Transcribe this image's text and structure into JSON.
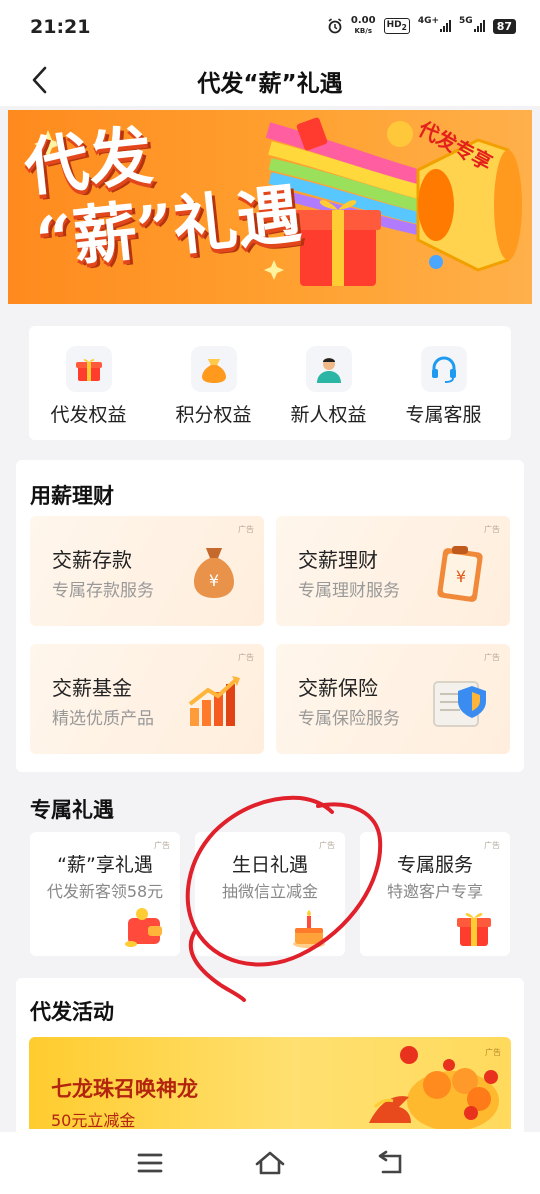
{
  "status_bar": {
    "time": "21:21",
    "net_speed": "0.00",
    "net_unit": "KB/s",
    "hd_label": "HD",
    "hd_sub": "2",
    "sig1": "4G+",
    "sig2": "5G",
    "battery": "87"
  },
  "header": {
    "title": "代发“薪”礼遇"
  },
  "banner": {
    "line1": "代发",
    "line2": "“薪”礼遇",
    "tag": "代发专享"
  },
  "quick": [
    {
      "label": "代发权益",
      "icon": "gift-icon"
    },
    {
      "label": "积分权益",
      "icon": "coin-bag-icon"
    },
    {
      "label": "新人权益",
      "icon": "person-icon"
    },
    {
      "label": "专属客服",
      "icon": "headset-icon"
    }
  ],
  "finance": {
    "title": "用薪理财",
    "ad": "广告",
    "items": [
      {
        "title": "交薪存款",
        "subtitle": "专属存款服务"
      },
      {
        "title": "交薪理财",
        "subtitle": "专属理财服务"
      },
      {
        "title": "交薪基金",
        "subtitle": "精选优质产品"
      },
      {
        "title": "交薪保险",
        "subtitle": "专属保险服务"
      }
    ]
  },
  "perks": {
    "title": "专属礼遇",
    "ad": "广告",
    "items": [
      {
        "title": "“薪”享礼遇",
        "subtitle": "代发新客领58元"
      },
      {
        "title": "生日礼遇",
        "subtitle": "抽微信立减金"
      },
      {
        "title": "专属服务",
        "subtitle": "特邀客户专享"
      }
    ]
  },
  "activity": {
    "title": "代发活动",
    "ad": "广告",
    "promo_title": "七龙珠召唤神龙",
    "promo_subtitle": "50元立减金"
  },
  "colors": {
    "accent": "#ff8a1e",
    "promo_text": "#b3240f",
    "annotation": "#e0202a"
  }
}
